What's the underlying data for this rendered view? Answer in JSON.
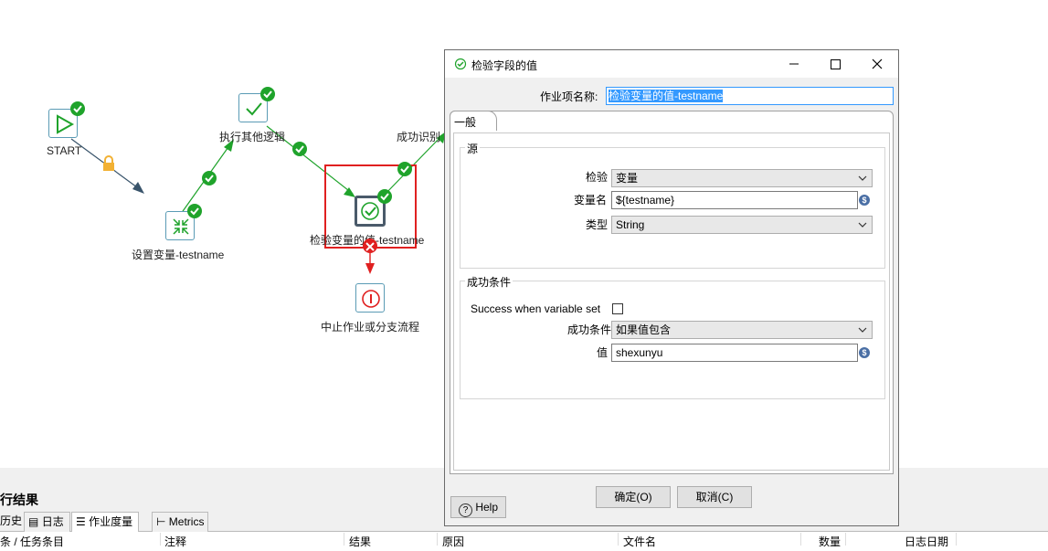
{
  "canvas": {
    "nodes": {
      "start": "START",
      "set_var": "设置变量-testname",
      "other_logic": "执行其他逻辑",
      "check_field": "检验变量的值-testname",
      "abort": "中止作业或分支流程",
      "success_partial": "成功识别"
    }
  },
  "bottom": {
    "title": "行结果",
    "tabs": [
      "历史",
      "日志",
      "作业度量",
      "Metrics"
    ],
    "columns": [
      "条 / 任务条目",
      "注释",
      "结果",
      "原因",
      "文件名",
      "数量",
      "日志日期"
    ]
  },
  "dialog": {
    "title": "检验字段的值",
    "job_name_label": "作业项名称:",
    "job_name_value": "检验变量的值-testname",
    "tab_general": "一般",
    "source_group": "源",
    "check_label": "检验",
    "check_value": "变量",
    "varname_label": "变量名",
    "varname_value": "${testname}",
    "type_label": "类型",
    "type_value": "String",
    "success_group": "成功条件",
    "success_when_set_label": "Success when variable set",
    "success_cond_label": "成功条件",
    "success_cond_value": "如果值包含",
    "value_label": "值",
    "value_value": "shexunyu",
    "help_label": "Help",
    "ok_label": "确定(O)",
    "cancel_label": "取消(C)",
    "var_icon": "$"
  },
  "colors": {
    "ok_green": "#1fa32b",
    "hop_green": "#1fa32b",
    "highlight_red": "#e02020",
    "selection_blue": "#3399ff"
  }
}
